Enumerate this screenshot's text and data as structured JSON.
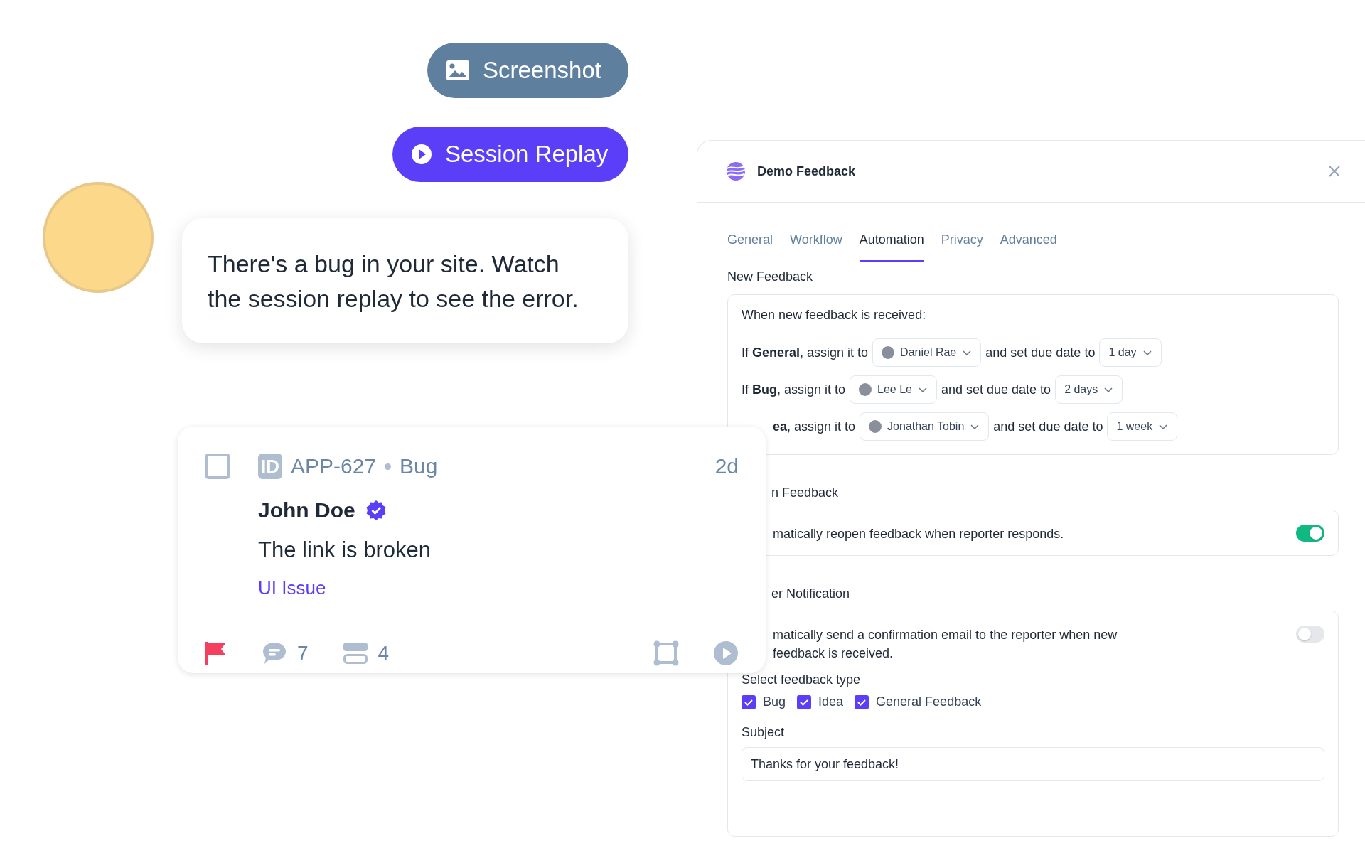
{
  "media_buttons": [
    {
      "kind": "screenshot",
      "label": "Screenshot"
    },
    {
      "kind": "replay",
      "label": "Session Replay"
    }
  ],
  "chat": {
    "message": "There's a bug in your site. Watch the session replay to see the error."
  },
  "feedback_card": {
    "checked": false,
    "id_badge": "ID",
    "id": "APP-627",
    "type": "Bug",
    "age": "2d",
    "author": "John Doe",
    "verified": true,
    "title": "The link is broken",
    "tag": "UI Issue",
    "flagged": true,
    "comments": "7",
    "attachments": "4"
  },
  "panel": {
    "title": "Demo Feedback",
    "tabs": [
      {
        "label": "General",
        "selected": false
      },
      {
        "label": "Workflow",
        "selected": false
      },
      {
        "label": "Automation",
        "selected": true
      },
      {
        "label": "Privacy",
        "selected": false
      },
      {
        "label": "Advanced",
        "selected": false
      }
    ],
    "sections": [
      {
        "kind": "rules",
        "title": "New Feedback",
        "intro": "When new feedback is received:",
        "rules": [
          {
            "condition": "If **General**, assign it to",
            "assignee": "Daniel Rae",
            "due_label": "and set due date to",
            "due": "1 day"
          },
          {
            "condition": "If **Bug**, assign it to",
            "assignee": "Lee Le",
            "due_label": "and set due date to",
            "due": "2 days"
          },
          {
            "condition": "**ea**, assign it to",
            "assignee": "Jonathan Tobin",
            "due_label": "and set due date to",
            "due": "1 week"
          }
        ]
      },
      {
        "kind": "toggle",
        "title": "n Feedback",
        "description": "matically reopen feedback when reporter responds.",
        "on": true
      },
      {
        "kind": "toggle",
        "title": "er Notification",
        "description": "matically send a confirmation email to the reporter when new feedback is received.",
        "on": false,
        "types_label": "Select feedback type",
        "types": [
          {
            "label": "Bug",
            "checked": true
          },
          {
            "label": "Idea",
            "checked": true
          },
          {
            "label": "General Feedback",
            "checked": true
          }
        ],
        "subject_label": "Subject",
        "subject": "Thanks for your feedback!"
      }
    ]
  }
}
